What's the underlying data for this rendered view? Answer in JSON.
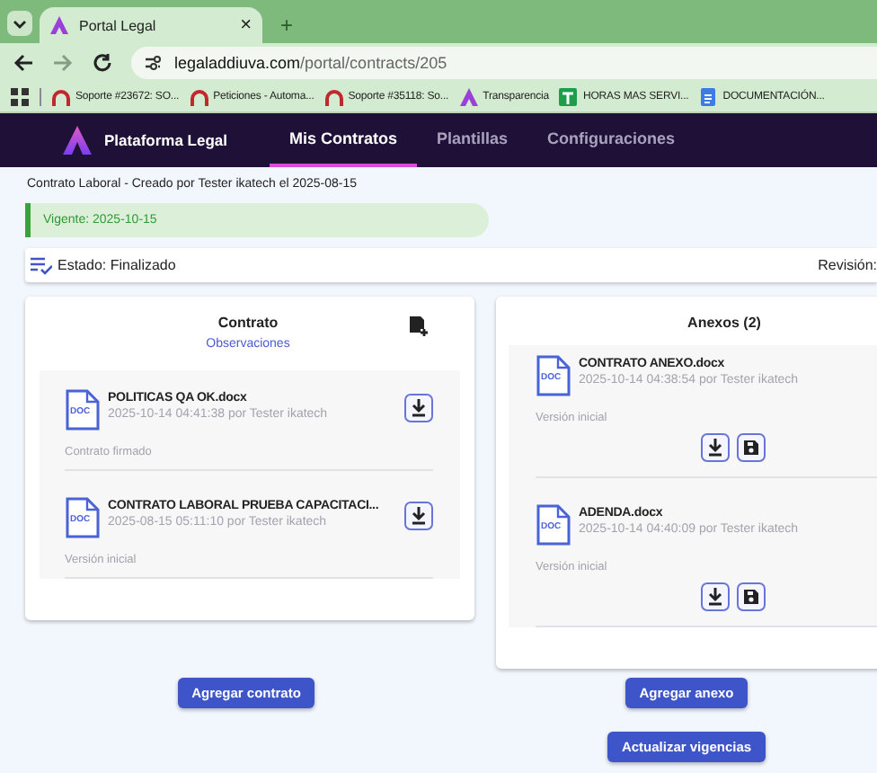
{
  "browser": {
    "tabs": [
      {
        "title": "Portal Legal",
        "close": "×",
        "selected": true
      }
    ],
    "new_tab": "+",
    "url": {
      "domain": "legaladdiuva.com",
      "path": "/portal/contracts/205"
    },
    "bookmarks": [
      {
        "label": "Soporte #23672: SO...",
        "kind": "arc"
      },
      {
        "label": "Peticiones - Automa...",
        "kind": "arc"
      },
      {
        "label": "Soporte #35118: So...",
        "kind": "arc"
      },
      {
        "label": "Transparencia",
        "kind": "logo"
      },
      {
        "label": "HORAS MAS SERVI...",
        "kind": "sheet"
      },
      {
        "label": "DOCUMENTACIÓN...",
        "kind": "doc"
      }
    ]
  },
  "app": {
    "brand": "Plataforma Legal",
    "nav": [
      {
        "label": "Mis Contratos",
        "selected": true
      },
      {
        "label": "Plantillas",
        "selected": false
      },
      {
        "label": "Configuraciones",
        "selected": false
      }
    ]
  },
  "contract": {
    "subtitle": "Contrato Laboral - Creado por Tester ikatech el 2025-08-15",
    "validity": "Vigente: 2025-10-15",
    "status": "Estado: Finalizado",
    "revision": "Revisión:"
  },
  "contract_panel": {
    "title": "Contrato",
    "link": "Observaciones",
    "files": [
      {
        "type": "DOC",
        "name": "POLITICAS QA OK.docx",
        "meta": "2025-10-14 04:41:38 por Tester ikatech",
        "note": "Contrato firmado"
      },
      {
        "type": "DOC",
        "name": "CONTRATO LABORAL PRUEBA CAPACITACI...",
        "meta": "2025-08-15 05:11:10 por Tester ikatech",
        "note": "Versión inicial"
      }
    ],
    "button": "Agregar contrato"
  },
  "annexes_panel": {
    "title": "Anexos (2)",
    "files": [
      {
        "type": "DOC",
        "name": "CONTRATO ANEXO.docx",
        "meta": "2025-10-14 04:38:54 por Tester ikatech",
        "note": "Versión inicial"
      },
      {
        "type": "DOC",
        "name": "ADENDA.docx",
        "meta": "2025-10-14 04:40:09 por Tester ikatech",
        "note": "Versión inicial"
      }
    ],
    "buttons": [
      "Agregar anexo",
      "Actualizar vigencias"
    ]
  }
}
